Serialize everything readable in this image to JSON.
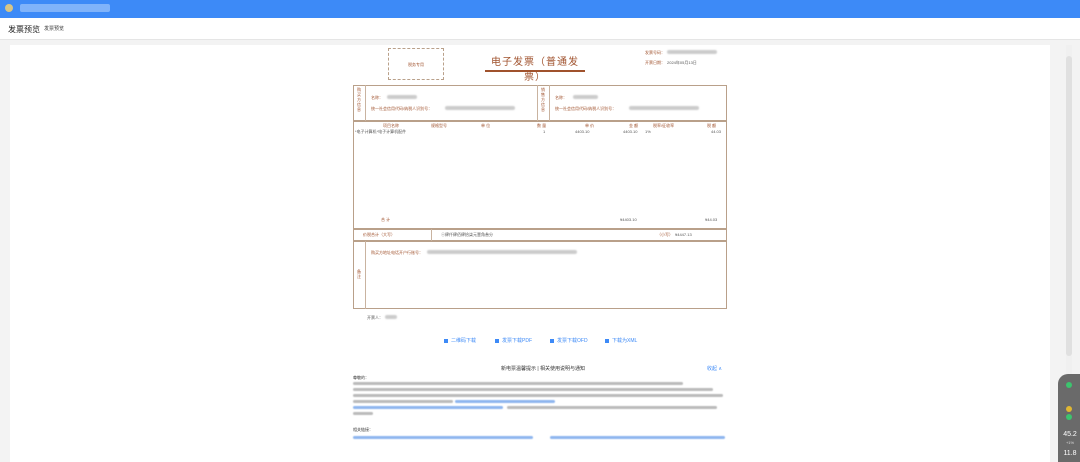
{
  "topbar": {
    "logo_icon": "app-logo-icon",
    "color": "#3d8af7"
  },
  "subhead": {
    "title": "发票预览",
    "crumb": "发票预览"
  },
  "invoice": {
    "stamp_label": "税务专用",
    "title": "电子发票（普通发票）",
    "meta": {
      "number_label": "发票号码：",
      "date_label": "开票日期：",
      "date_value": "2024年05月13日"
    },
    "buyer": {
      "side_label": "购买方信息",
      "name_label": "名称：",
      "tax_label": "统一社会信用代码/纳税人识别号："
    },
    "seller": {
      "side_label": "销售方信息",
      "name_label": "名称：",
      "tax_label": "统一社会信用代码/纳税人识别号："
    },
    "items": {
      "headers": [
        "项目名称",
        "规格型号",
        "单 位",
        "数 量",
        "单 价",
        "金 额",
        "税率/征收率",
        "税 额"
      ],
      "row": [
        "*电子计算机*电子计算机配件",
        "",
        "",
        "1",
        "4403.10",
        "4403.10",
        "1%",
        "44.03"
      ]
    },
    "total": {
      "label": "合 计",
      "amount": "¥4403.10",
      "tax": "¥44.03"
    },
    "grand_total": {
      "label": "价税合计（大写）",
      "capital": "ⓧ肆仟肆佰肆拾柒元壹角叁分",
      "small_label": "（小写）",
      "small_value": "¥4447.13"
    },
    "remarks": {
      "side_label": "备注",
      "line_label": "购买方地址电话开户行账号："
    },
    "issuer_label": "开票人："
  },
  "downloads": [
    {
      "label": "二维码下载"
    },
    {
      "label": "发票下载PDF"
    },
    {
      "label": "发票下载OFD"
    },
    {
      "label": "下载为XML"
    }
  ],
  "notice": {
    "title": "新电票温馨提示 | 相关使用说明与通知",
    "collapse": "收起 ∧",
    "head": "尊敬的：",
    "links_head": "相关链接："
  },
  "float_panel": {
    "value1": "45.2",
    "value1_sub": "+1%",
    "value2": "11.8"
  }
}
